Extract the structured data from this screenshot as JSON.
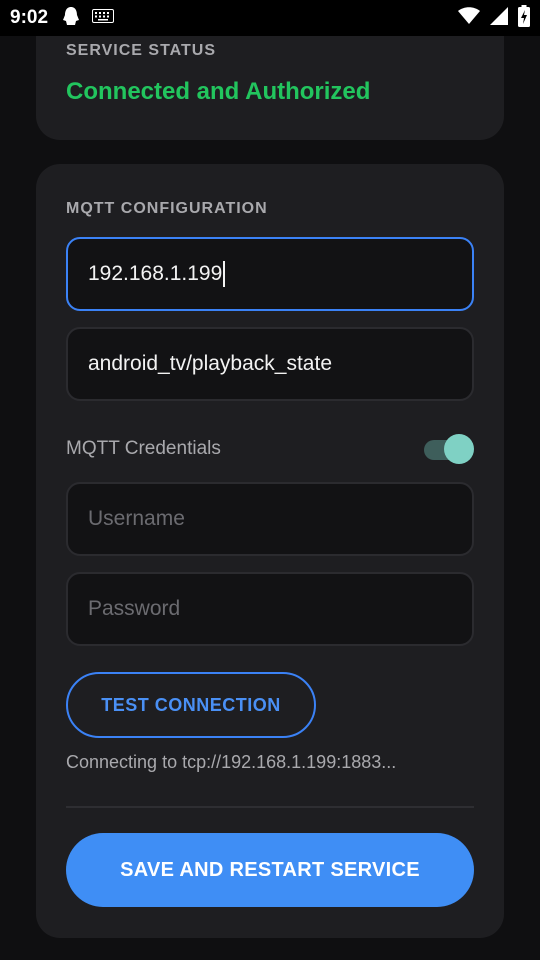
{
  "statusbar": {
    "time": "9:02",
    "icons": [
      "notification-icon",
      "keyboard-icon",
      "wifi-icon",
      "signal-icon",
      "battery-icon"
    ]
  },
  "service_status": {
    "label": "SERVICE STATUS",
    "value": "Connected and Authorized",
    "value_color": "#22c55e"
  },
  "mqtt": {
    "section_label": "MQTT CONFIGURATION",
    "host_value": "192.168.1.199",
    "topic_value": "android_tv/playback_state",
    "credentials_label": "MQTT Credentials",
    "credentials_enabled": true,
    "username_placeholder": "Username",
    "password_placeholder": "Password",
    "test_button": "TEST CONNECTION",
    "connecting_text": "Connecting to tcp://192.168.1.199:1883...",
    "save_button": "SAVE AND RESTART SERVICE"
  },
  "colors": {
    "accent": "#3b82f6",
    "toggle_thumb": "#7fd1c4",
    "card_bg": "#1e1e21",
    "page_bg": "#0f0f11"
  }
}
